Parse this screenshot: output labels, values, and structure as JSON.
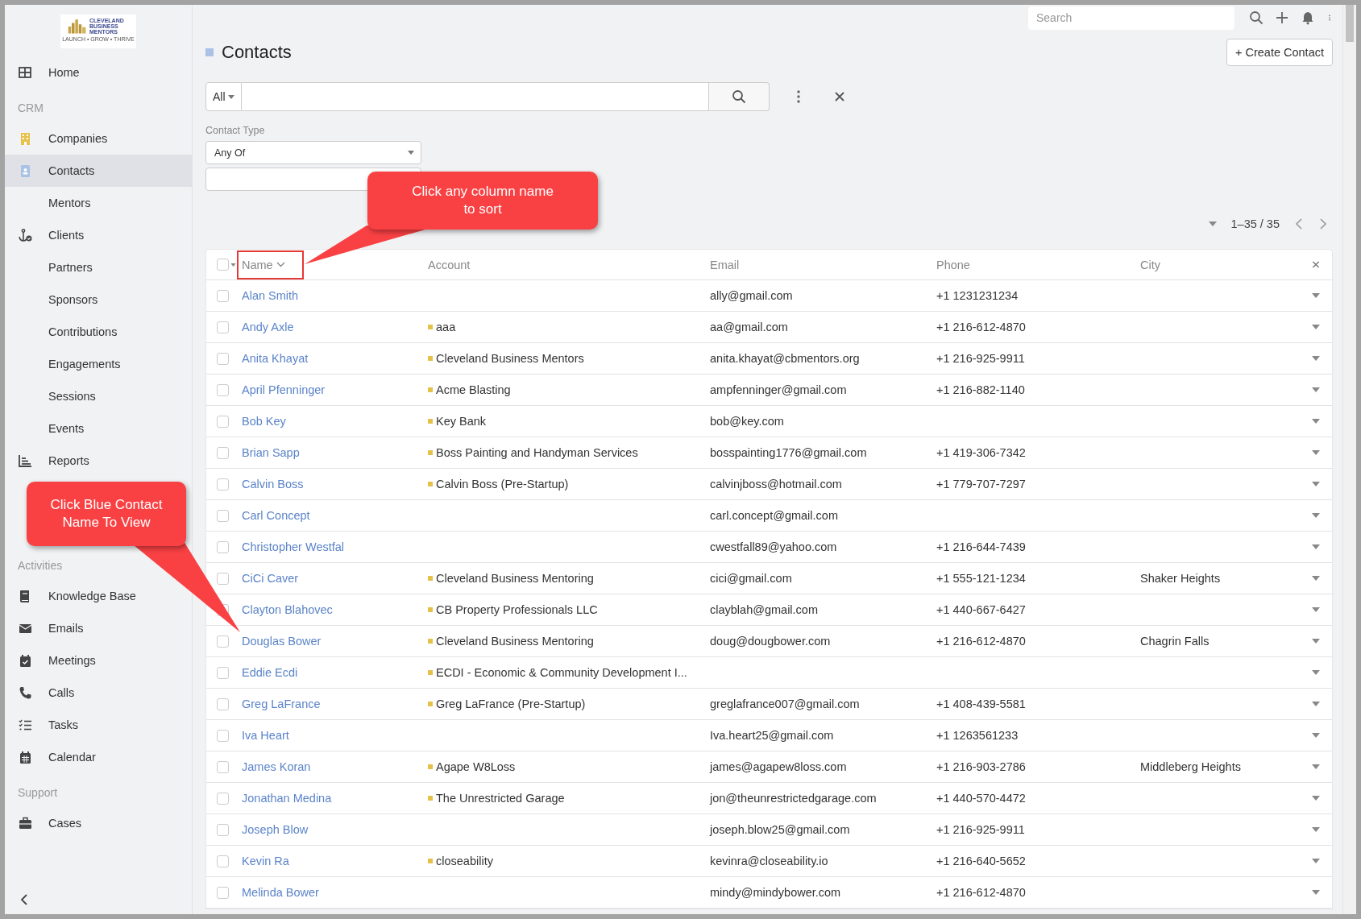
{
  "logo": {
    "text": "CLEVELAND BUSINESS MENTORS",
    "tagline": "LAUNCH • GROW • THRIVE"
  },
  "sidebar": {
    "items": [
      {
        "kind": "link",
        "label": "Home",
        "selected": false
      },
      {
        "kind": "section",
        "label": "CRM"
      },
      {
        "kind": "link",
        "label": "Companies",
        "selected": false
      },
      {
        "kind": "link",
        "label": "Contacts",
        "selected": true
      },
      {
        "kind": "sublink",
        "label": "Mentors",
        "selected": false
      },
      {
        "kind": "link",
        "label": "Clients",
        "selected": false
      },
      {
        "kind": "sublink",
        "label": "Partners",
        "selected": false
      },
      {
        "kind": "sublink",
        "label": "Sponsors",
        "selected": false
      },
      {
        "kind": "sublink",
        "label": "Contributions",
        "selected": false
      },
      {
        "kind": "sublink",
        "label": "Engagements",
        "selected": false
      },
      {
        "kind": "sublink",
        "label": "Sessions",
        "selected": false
      },
      {
        "kind": "sublink",
        "label": "Events",
        "selected": false
      },
      {
        "kind": "link",
        "label": "Reports",
        "selected": false
      },
      {
        "kind": "section",
        "label": "Activities"
      },
      {
        "kind": "link",
        "label": "Knowledge Base",
        "selected": false
      },
      {
        "kind": "link",
        "label": "Emails",
        "selected": false
      },
      {
        "kind": "link",
        "label": "Meetings",
        "selected": false
      },
      {
        "kind": "link",
        "label": "Calls",
        "selected": false
      },
      {
        "kind": "link",
        "label": "Tasks",
        "selected": false
      },
      {
        "kind": "link",
        "label": "Calendar",
        "selected": false
      },
      {
        "kind": "section",
        "label": "Support"
      },
      {
        "kind": "link",
        "label": "Cases",
        "selected": false
      }
    ]
  },
  "topbar": {
    "search_placeholder": "Search"
  },
  "page": {
    "title": "Contacts",
    "create_button": "+ Create Contact"
  },
  "search": {
    "scope": "All"
  },
  "filter": {
    "label": "Contact Type",
    "operator": "Any Of"
  },
  "pagination": {
    "range": "1–35 / 35"
  },
  "table": {
    "select_all_checked": false,
    "columns": [
      "Name",
      "Account",
      "Email",
      "Phone",
      "City"
    ],
    "rows": [
      {
        "name": "Alan Smith",
        "account": "",
        "email": "ally@gmail.com",
        "phone": "+1 1231231234",
        "city": "",
        "checked": false
      },
      {
        "name": "Andy Axle",
        "account": "aaa",
        "email": "aa@gmail.com",
        "phone": "+1 216-612-4870",
        "city": "",
        "checked": false
      },
      {
        "name": "Anita Khayat",
        "account": "Cleveland Business Mentors",
        "email": "anita.khayat@cbmentors.org",
        "phone": "+1 216-925-9911",
        "city": "",
        "checked": false
      },
      {
        "name": "April Pfenninger",
        "account": "Acme Blasting",
        "email": "ampfenninger@gmail.com",
        "phone": "+1 216-882-1140",
        "city": "",
        "checked": false
      },
      {
        "name": "Bob Key",
        "account": "Key Bank",
        "email": "bob@key.com",
        "phone": "",
        "city": "",
        "checked": false
      },
      {
        "name": "Brian Sapp",
        "account": "Boss Painting and Handyman Services",
        "email": "bosspainting1776@gmail.com",
        "phone": "+1 419-306-7342",
        "city": "",
        "checked": false
      },
      {
        "name": "Calvin Boss",
        "account": "Calvin Boss (Pre-Startup)",
        "email": "calvinjboss@hotmail.com",
        "phone": "+1 779-707-7297",
        "city": "",
        "checked": false
      },
      {
        "name": "Carl Concept",
        "account": "",
        "email": "carl.concept@gmail.com",
        "phone": "",
        "city": "",
        "checked": false
      },
      {
        "name": "Christopher Westfal",
        "account": "",
        "email": "cwestfall89@yahoo.com",
        "phone": "+1 216-644-7439",
        "city": "",
        "checked": false
      },
      {
        "name": "CiCi Caver",
        "account": "Cleveland Business Mentoring",
        "email": "cici@gmail.com",
        "phone": "+1 555-121-1234",
        "city": "Shaker Heights",
        "checked": false
      },
      {
        "name": "Clayton Blahovec",
        "account": "CB Property Professionals LLC",
        "email": "clayblah@gmail.com",
        "phone": "+1 440-667-6427",
        "city": "",
        "checked": false
      },
      {
        "name": "Douglas Bower",
        "account": "Cleveland Business Mentoring",
        "email": "doug@dougbower.com",
        "phone": "+1 216-612-4870",
        "city": "Chagrin Falls",
        "checked": false
      },
      {
        "name": "Eddie Ecdi",
        "account": "ECDI - Economic & Community Development I...",
        "email": "",
        "phone": "",
        "city": "",
        "checked": false
      },
      {
        "name": "Greg LaFrance",
        "account": "Greg LaFrance (Pre-Startup)",
        "email": "greglafrance007@gmail.com",
        "phone": "+1 408-439-5581",
        "city": "",
        "checked": false
      },
      {
        "name": "Iva Heart",
        "account": "",
        "email": "Iva.heart25@gmail.com",
        "phone": "+1 1263561233",
        "city": "",
        "checked": false
      },
      {
        "name": "James Koran",
        "account": "Agape W8Loss",
        "email": "james@agapew8loss.com",
        "phone": "+1 216-903-2786",
        "city": "Middleberg Heights",
        "checked": false
      },
      {
        "name": "Jonathan Medina",
        "account": "The Unrestricted Garage",
        "email": "jon@theunrestrictedgarage.com",
        "phone": "+1 440-570-4472",
        "city": "",
        "checked": false
      },
      {
        "name": "Joseph Blow",
        "account": "",
        "email": "joseph.blow25@gmail.com",
        "phone": "+1 216-925-9911",
        "city": "",
        "checked": false
      },
      {
        "name": "Kevin Ra",
        "account": "closeability",
        "email": "kevinra@closeability.io",
        "phone": "+1 216-640-5652",
        "city": "",
        "checked": false
      },
      {
        "name": "Melinda Bower",
        "account": "",
        "email": "mindy@mindybower.com",
        "phone": "+1 216-612-4870",
        "city": "",
        "checked": false
      }
    ]
  },
  "callouts": [
    {
      "text": "Click any column name to sort"
    },
    {
      "text": "Click Blue Contact Name To View"
    }
  ]
}
